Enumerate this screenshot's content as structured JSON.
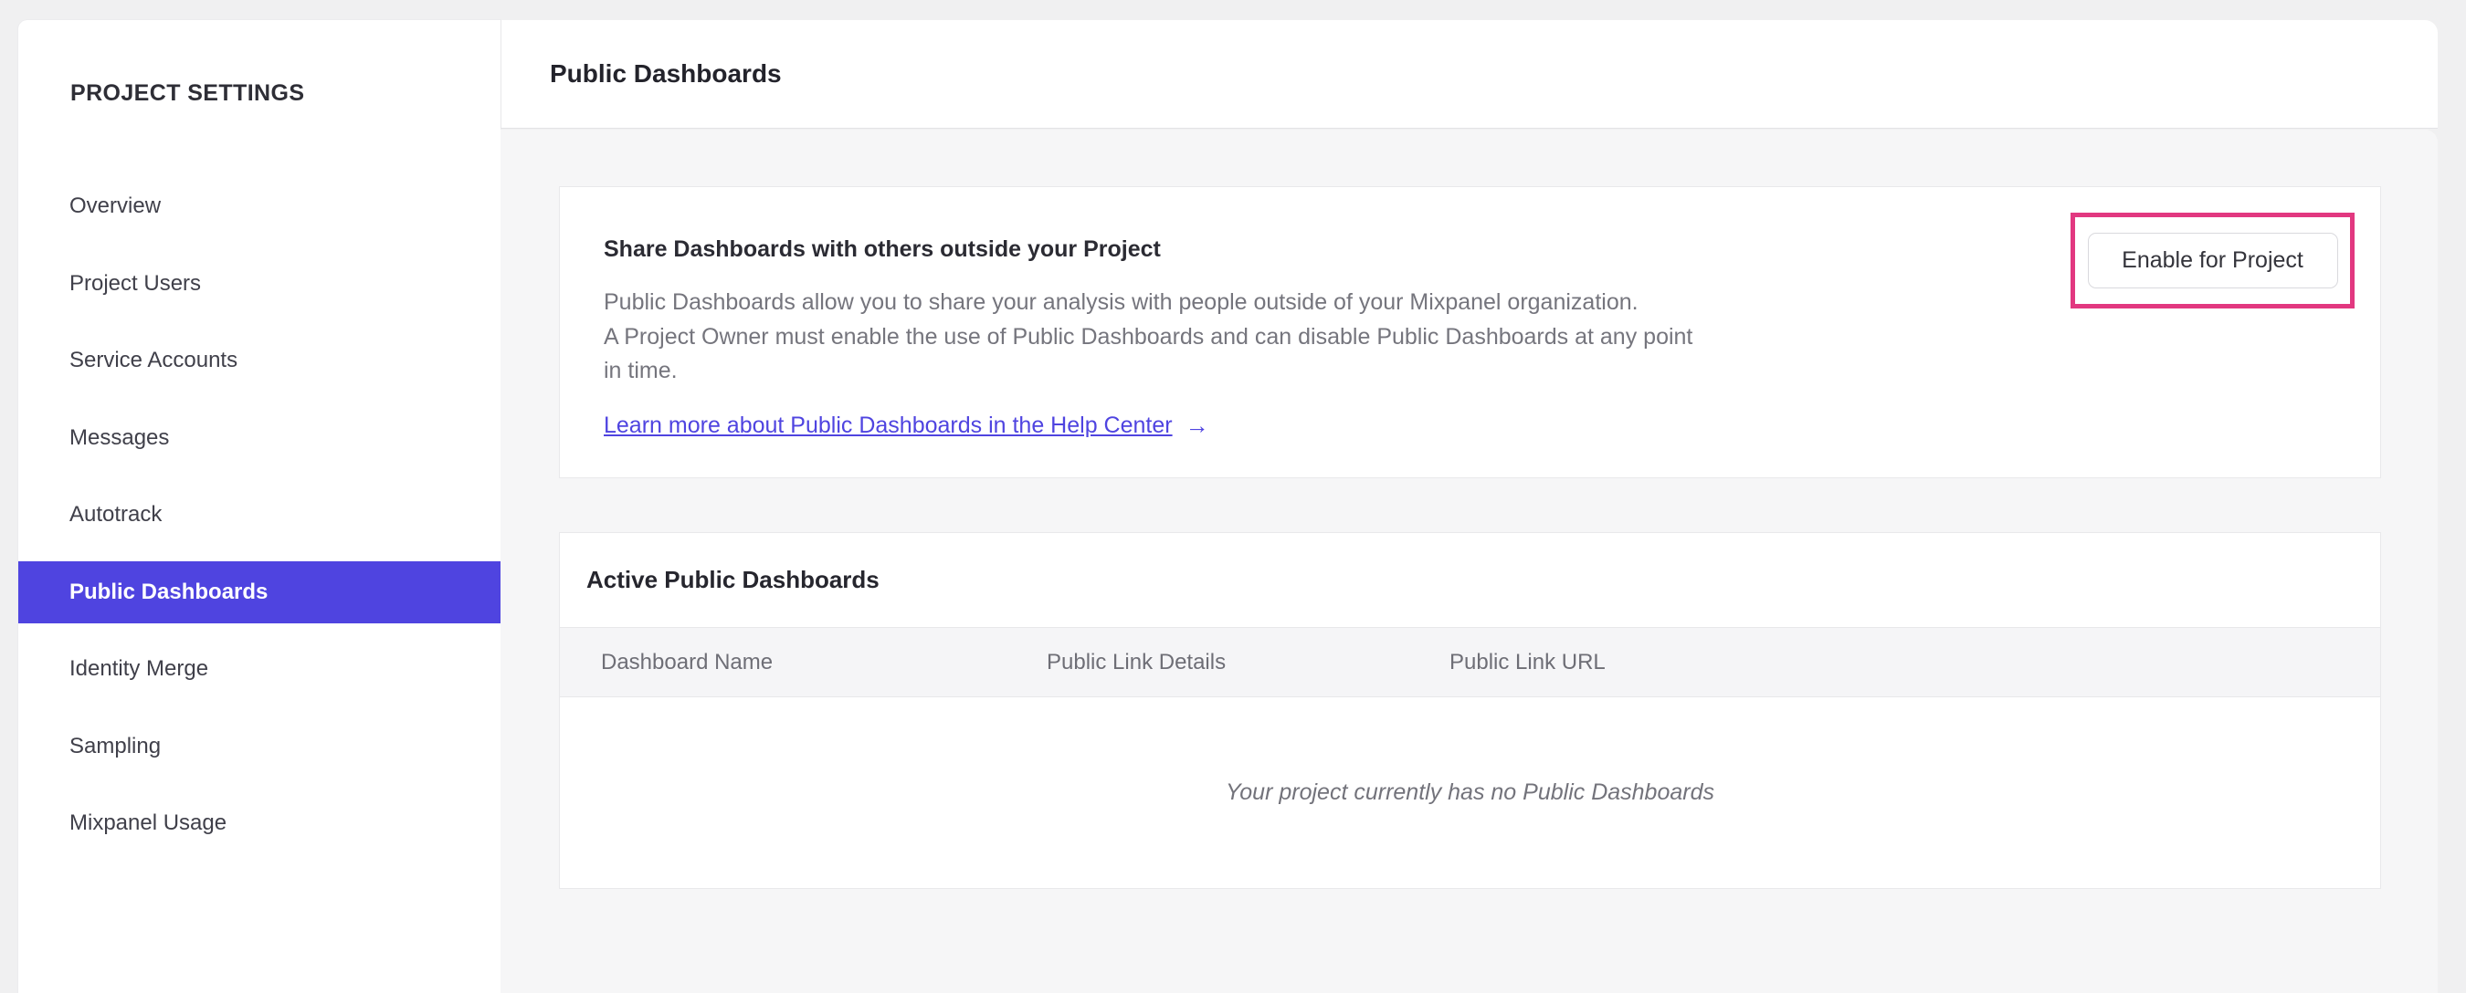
{
  "sidebar": {
    "title": "PROJECT SETTINGS",
    "items": [
      {
        "label": "Overview",
        "selected": false
      },
      {
        "label": "Project Users",
        "selected": false
      },
      {
        "label": "Service Accounts",
        "selected": false
      },
      {
        "label": "Messages",
        "selected": false
      },
      {
        "label": "Autotrack",
        "selected": false
      },
      {
        "label": "Public Dashboards",
        "selected": true
      },
      {
        "label": "Identity Merge",
        "selected": false
      },
      {
        "label": "Sampling",
        "selected": false
      },
      {
        "label": "Mixpanel Usage",
        "selected": false
      }
    ]
  },
  "header": {
    "title": "Public Dashboards"
  },
  "share_card": {
    "heading": "Share Dashboards with others outside your Project",
    "body_lines": [
      "Public Dashboards allow you to share your analysis with people outside of your Mixpanel organization.",
      "A Project Owner must enable the use of Public Dashboards and can disable Public Dashboards at any point",
      "in time."
    ],
    "link_label": "Learn more about Public Dashboards in the Help Center",
    "link_arrow": "→",
    "button_label": "Enable for Project"
  },
  "active_card": {
    "title": "Active Public Dashboards",
    "columns": [
      "Dashboard Name",
      "Public Link Details",
      "Public Link URL"
    ],
    "empty_message": "Your project currently has no Public Dashboards"
  },
  "colors": {
    "accent_purple": "#4f44e0",
    "link_purple": "#4f44e0",
    "annotation_pink": "#e23880"
  }
}
